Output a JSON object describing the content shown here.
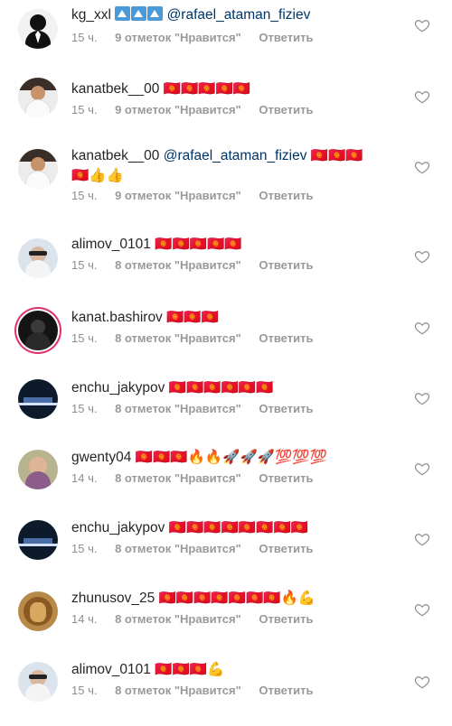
{
  "comments": [
    {
      "username": "kg_xxl",
      "prefix": "🔺🔺🔺",
      "mention": "@rafael_ataman_fiziev",
      "text": "",
      "time": "15 ч.",
      "likes": "9 отметок \"Нравится\"",
      "reply": "Ответить",
      "avatar": "person-silhouette"
    },
    {
      "username": "kanatbek__00",
      "prefix": "",
      "mention": "",
      "text": "🇰🇬🇰🇬🇰🇬🇰🇬🇰🇬",
      "time": "15 ч.",
      "likes": "9 отметок \"Нравится\"",
      "reply": "Ответить",
      "avatar": "man-white-shirt"
    },
    {
      "username": "kanatbek__00",
      "prefix": "",
      "mention": "@rafael_ataman_fiziev",
      "text": "🇰🇬🇰🇬🇰🇬",
      "text2": "🇰🇬👍👍",
      "time": "15 ч.",
      "likes": "9 отметок \"Нравится\"",
      "reply": "Ответить",
      "avatar": "man-white-shirt"
    },
    {
      "username": "alimov_0101",
      "prefix": "",
      "mention": "",
      "text": "🇰🇬🇰🇬🇰🇬🇰🇬🇰🇬",
      "time": "15 ч.",
      "likes": "8 отметок \"Нравится\"",
      "reply": "Ответить",
      "avatar": "man-sunglasses"
    },
    {
      "username": "kanat.bashirov",
      "prefix": "",
      "mention": "",
      "text": "🇰🇬🇰🇬🇰🇬",
      "time": "15 ч.",
      "likes": "8 отметок \"Нравится\"",
      "reply": "Ответить",
      "avatar": "dark-story"
    },
    {
      "username": "enchu_jakypov",
      "prefix": "",
      "mention": "",
      "text": "🇰🇬🇰🇬🇰🇬🇰🇬🇰🇬🇰🇬",
      "time": "15 ч.",
      "likes": "8 отметок \"Нравится\"",
      "reply": "Ответить",
      "avatar": "night-city"
    },
    {
      "username": "gwenty04",
      "prefix": "",
      "mention": "",
      "text": "🇰🇬🇰🇬🇰🇬🔥🔥🚀🚀🚀💯💯💯",
      "time": "14 ч.",
      "likes": "8 отметок \"Нравится\"",
      "reply": "Ответить",
      "avatar": "woman-portrait"
    },
    {
      "username": "enchu_jakypov",
      "prefix": "",
      "mention": "",
      "text": "🇰🇬🇰🇬🇰🇬🇰🇬🇰🇬🇰🇬🇰🇬🇰🇬",
      "time": "15 ч.",
      "likes": "8 отметок \"Нравится\"",
      "reply": "Ответить",
      "avatar": "night-city"
    },
    {
      "username": "zhunusov_25",
      "prefix": "",
      "mention": "",
      "text": "🇰🇬🇰🇬🇰🇬🇰🇬🇰🇬🇰🇬🇰🇬🔥💪",
      "time": "14 ч.",
      "likes": "8 отметок \"Нравится\"",
      "reply": "Ответить",
      "avatar": "lion"
    },
    {
      "username": "alimov_0101",
      "prefix": "",
      "mention": "",
      "text": "🇰🇬🇰🇬🇰🇬💪",
      "time": "15 ч.",
      "likes": "8 отметок \"Нравится\"",
      "reply": "Ответить",
      "avatar": "man-sunglasses"
    }
  ],
  "icons": {
    "like": "heart-outline-icon"
  },
  "colors": {
    "username": "#262626",
    "mention": "#003569",
    "meta": "#8e8e8e",
    "story_ring": "#e1306c"
  }
}
